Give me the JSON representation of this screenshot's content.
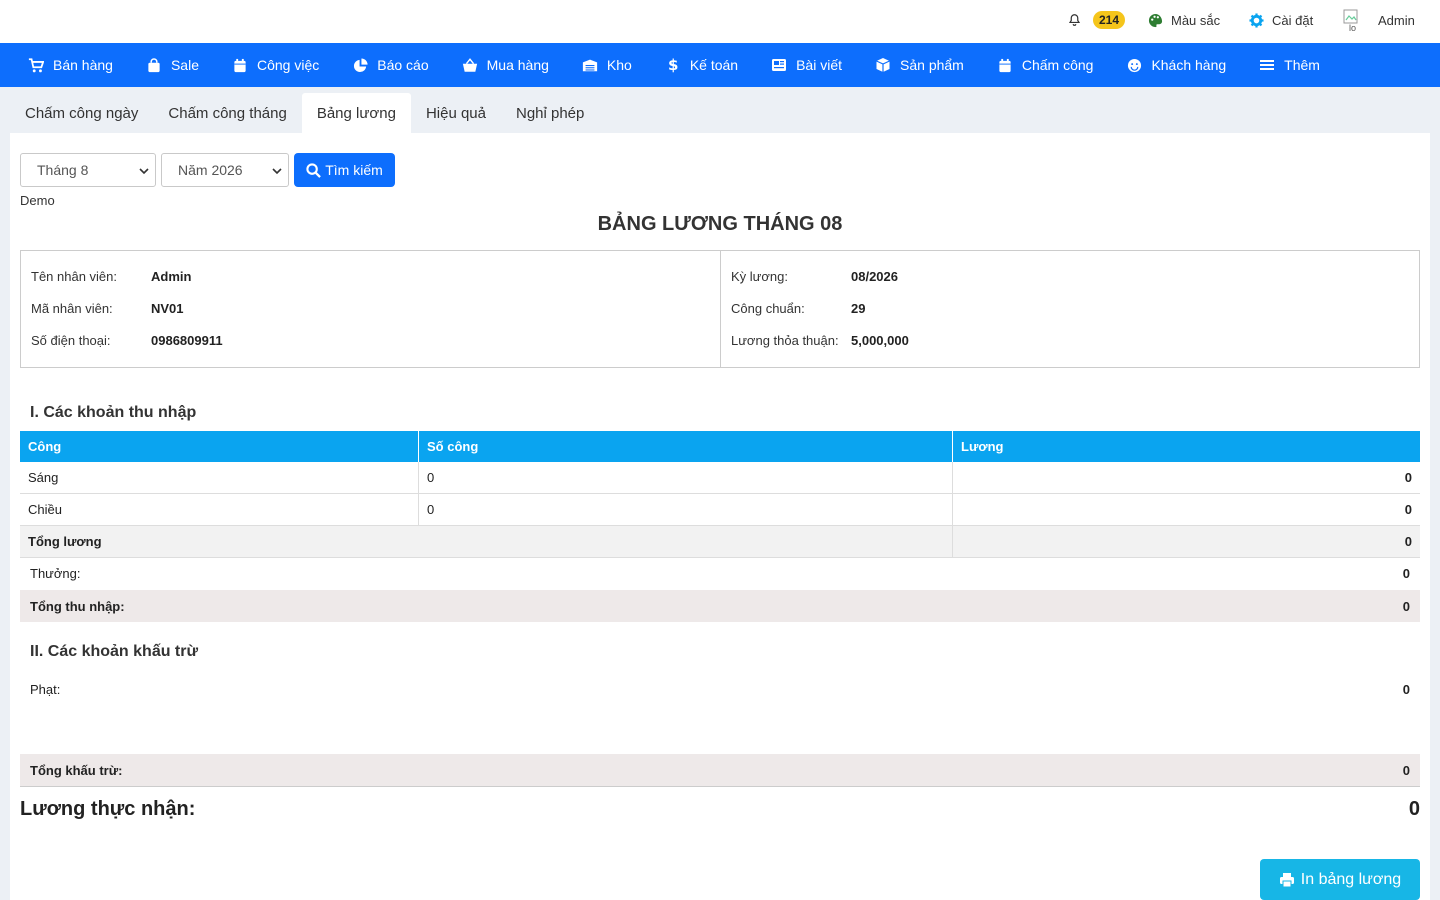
{
  "topbar": {
    "notification_count": "214",
    "colors_label": "Màu sắc",
    "settings_label": "Cài đặt",
    "user_name": "Admin",
    "avatar_alt": "lo"
  },
  "nav": {
    "items": [
      {
        "label": "Bán hàng",
        "icon": "cart-icon"
      },
      {
        "label": "Sale",
        "icon": "bag-icon"
      },
      {
        "label": "Công việc",
        "icon": "calendar-icon"
      },
      {
        "label": "Báo cáo",
        "icon": "pie-chart-icon"
      },
      {
        "label": "Mua hàng",
        "icon": "basket-icon"
      },
      {
        "label": "Kho",
        "icon": "warehouse-icon"
      },
      {
        "label": "Kế toán",
        "icon": "dollar-icon"
      },
      {
        "label": "Bài viết",
        "icon": "newspaper-icon"
      },
      {
        "label": "Sản phẩm",
        "icon": "box-icon"
      },
      {
        "label": "Chấm công",
        "icon": "calendar-icon"
      },
      {
        "label": "Khách hàng",
        "icon": "smile-icon"
      },
      {
        "label": "Thêm",
        "icon": "menu-icon"
      }
    ]
  },
  "tabs": [
    {
      "label": "Chấm công ngày"
    },
    {
      "label": "Chấm công tháng"
    },
    {
      "label": "Bảng lương"
    },
    {
      "label": "Hiệu quả"
    },
    {
      "label": "Nghỉ phép"
    }
  ],
  "filters": {
    "month": "Tháng 8",
    "year": "Năm 2026",
    "search_label": "Tìm kiếm"
  },
  "company": "Demo",
  "title": "BẢNG LƯƠNG THÁNG 08",
  "employee": {
    "name_label": "Tên nhân viên:",
    "name": "Admin",
    "code_label": "Mã nhân viên:",
    "code": "NV01",
    "phone_label": "Số điện thoại:",
    "phone": "0986809911"
  },
  "period": {
    "period_label": "Kỳ lương:",
    "period": "08/2026",
    "standard_label": "Công chuẩn:",
    "standard": "29",
    "salary_label": "Lương thỏa thuận:",
    "salary": "5,000,000"
  },
  "income": {
    "heading": "I. Các khoản thu nhập",
    "columns": [
      "Công",
      "Số công",
      "Lương"
    ],
    "rows": [
      {
        "shift": "Sáng",
        "days": "0",
        "amount": "0"
      },
      {
        "shift": "Chiều",
        "days": "0",
        "amount": "0"
      }
    ],
    "total_salary_label": "Tổng lương",
    "total_salary": "0",
    "bonus_label": "Thưởng:",
    "bonus": "0",
    "total_income_label": "Tổng thu nhập:",
    "total_income": "0"
  },
  "deductions": {
    "heading": "II. Các khoản khấu trừ",
    "fine_label": "Phạt:",
    "fine": "0",
    "total_label": "Tổng khấu trừ:",
    "total": "0"
  },
  "net": {
    "label": "Lương thực nhận:",
    "value": "0"
  },
  "print_label": "In bảng lương"
}
